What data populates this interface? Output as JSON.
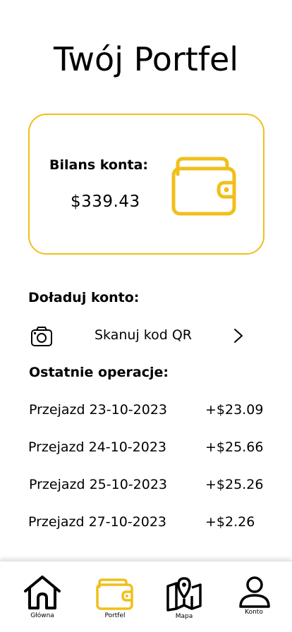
{
  "page": {
    "title": "Twój Portfel"
  },
  "balance": {
    "label": "Bilans konta:",
    "amount": "$339.43",
    "icon": "wallet-icon",
    "accent_color": "#f0bf1a"
  },
  "topup": {
    "title": "Doładuj konto:",
    "scan_label": "Skanuj kod QR",
    "scan_icon": "camera-icon",
    "arrow_icon": "chevron-right-icon"
  },
  "operations": {
    "title": "Ostatnie operacje:",
    "items": [
      {
        "name": "Przejazd 23-10-2023",
        "amount": "+$23.09"
      },
      {
        "name": "Przejazd 24-10-2023",
        "amount": "+$25.66"
      },
      {
        "name": "Przejazd 25-10-2023",
        "amount": "+$25.26"
      },
      {
        "name": "Przejazd 27-10-2023",
        "amount": "+$2.26"
      }
    ]
  },
  "nav": {
    "items": [
      {
        "label": "Główna",
        "icon": "home-icon",
        "active": false
      },
      {
        "label": "Portfel",
        "icon": "wallet-icon",
        "active": true
      },
      {
        "label": "Mapa",
        "icon": "map-icon",
        "active": false
      },
      {
        "label": "Konto",
        "icon": "user-icon",
        "active": false
      }
    ],
    "active_color": "#f0bf1a"
  }
}
